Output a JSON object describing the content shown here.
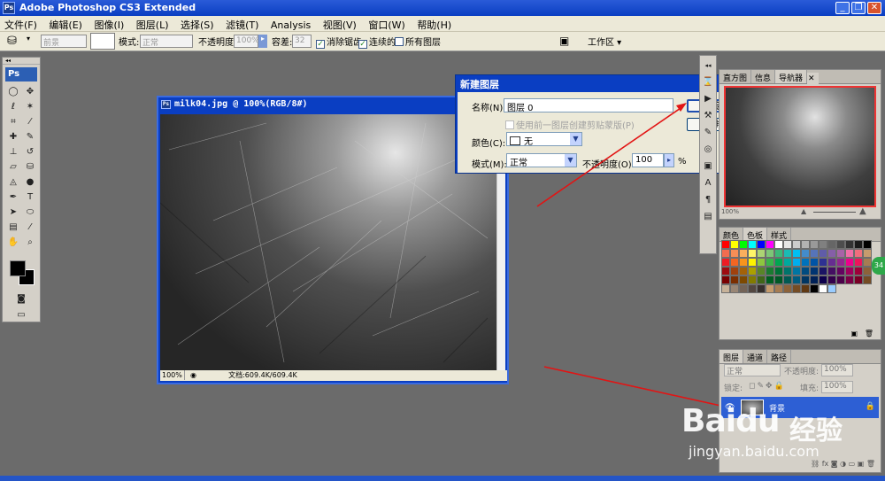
{
  "app": {
    "title": "Adobe Photoshop CS3 Extended",
    "logo": "Ps"
  },
  "menu": [
    "文件(F)",
    "编辑(E)",
    "图像(I)",
    "图层(L)",
    "选择(S)",
    "滤镜(T)",
    "Analysis",
    "视图(V)",
    "窗口(W)",
    "帮助(H)"
  ],
  "options": {
    "preset": "前景",
    "mode_label": "模式:",
    "mode_value": "正常",
    "opacity_label": "不透明度:",
    "opacity_value": "100%",
    "tolerance_label": "容差:",
    "tolerance_value": "32",
    "antialias_label": "消除锯齿",
    "contiguous_label": "连续的",
    "all_layers_label": "所有图层",
    "workspace_label": "工作区 ▾"
  },
  "toolbox": {
    "brand": "Ps"
  },
  "document": {
    "title": "milk04.jpg @ 100%(RGB/8#)",
    "zoom": "100%",
    "doc_info": "文档:609.4K/609.4K"
  },
  "dialog": {
    "title": "新建图层",
    "name_label": "名称(N):",
    "name_value": "图层 0",
    "clip_label": "使用前一图层创建剪贴蒙版(P)",
    "color_label": "颜色(C):",
    "color_value": "无",
    "mode_label": "模式(M):",
    "mode_value": "正常",
    "opacity_label": "不透明度(O):",
    "opacity_value": "100",
    "opacity_unit": "%",
    "ok_label": "确定",
    "cancel_label": "取消"
  },
  "navigator": {
    "tabs": [
      "直方图",
      "信息",
      "导航器"
    ],
    "zoom": "100%"
  },
  "swatches_panel": {
    "tabs": [
      "颜色",
      "色板",
      "样式"
    ],
    "colors": [
      "#ff0000",
      "#ffff00",
      "#00ff00",
      "#00ffff",
      "#0000ff",
      "#ff00ff",
      "#ffffff",
      "#e6e6e6",
      "#cccccc",
      "#b3b3b3",
      "#999999",
      "#808080",
      "#666666",
      "#4d4d4d",
      "#333333",
      "#1a1a1a",
      "#000000",
      "#f26c4f",
      "#f68e56",
      "#fbaf5d",
      "#fff568",
      "#acd373",
      "#7cc576",
      "#3bb878",
      "#1abbb4",
      "#00bff3",
      "#438ccb",
      "#5674b9",
      "#605ca8",
      "#855fa8",
      "#a763a8",
      "#f06ea9",
      "#f26d7d",
      "#c69c6d",
      "#ed1c24",
      "#f26522",
      "#f7941d",
      "#fff200",
      "#8dc63f",
      "#39b54a",
      "#00a651",
      "#00a99d",
      "#00aeef",
      "#0072bc",
      "#0054a6",
      "#2e3192",
      "#662d91",
      "#92278f",
      "#ec008c",
      "#ed145b",
      "#a67c52",
      "#9e0b0f",
      "#a0410d",
      "#a36209",
      "#aba000",
      "#598527",
      "#1a7b30",
      "#007236",
      "#00746b",
      "#0076a3",
      "#004b80",
      "#003471",
      "#1b1464",
      "#440e62",
      "#630460",
      "#9e005d",
      "#9e0039",
      "#8c6239",
      "#790000",
      "#7b2e00",
      "#7d4900",
      "#827b00",
      "#406618",
      "#005e20",
      "#005826",
      "#005952",
      "#005b7f",
      "#003663",
      "#002157",
      "#0d004c",
      "#32004b",
      "#4b0049",
      "#7b0046",
      "#7a0026",
      "#754c24",
      "#c7b299",
      "#998675",
      "#736357",
      "#534741",
      "#37302d",
      "#c69c6d",
      "#a67c52",
      "#8c6239",
      "#754c24",
      "#603913",
      "#000000",
      "#ffffff",
      "#99ccff"
    ]
  },
  "layers_panel": {
    "tabs": [
      "图层",
      "通道",
      "路径"
    ],
    "blend_mode": "正常",
    "opacity_label": "不透明度:",
    "opacity_value": "100%",
    "lock_label": "锁定:",
    "fill_label": "填充:",
    "fill_value": "100%",
    "layer_name": "背景"
  },
  "watermark": {
    "brand": "Baidu",
    "brand_cn": "经验",
    "url": "jingyan.baidu.com"
  },
  "callout": "34"
}
